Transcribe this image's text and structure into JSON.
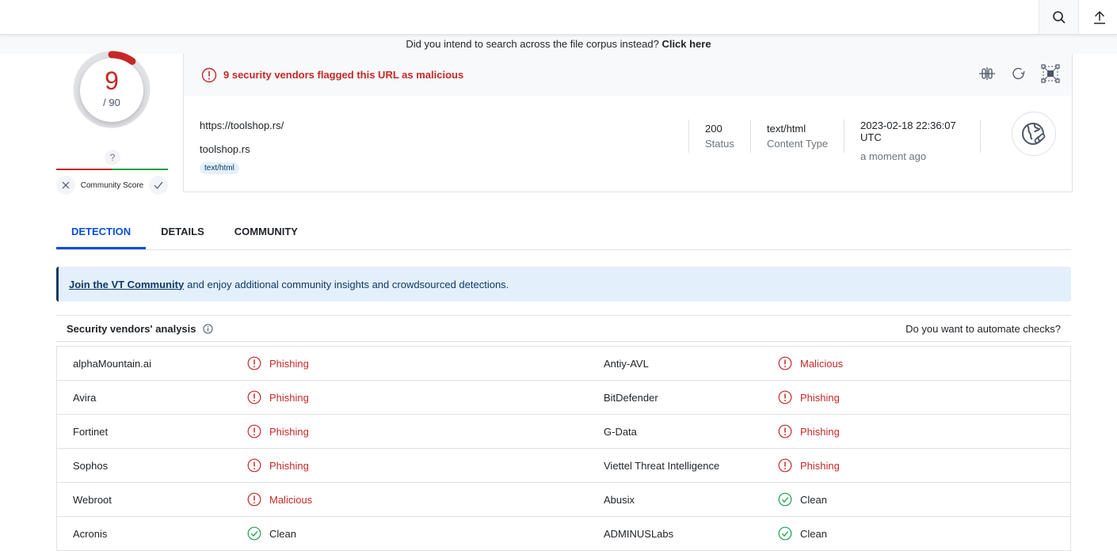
{
  "topbar": {
    "search_icon": "search-icon",
    "upload_icon": "upload-icon"
  },
  "notice": {
    "text": "Did you intend to search across the file corpus instead?",
    "link": "Click here"
  },
  "score": {
    "detections": "9",
    "total": "/ 90",
    "detection_fraction": 0.1,
    "community_unknown": "?",
    "community_label": "Community Score",
    "colors": {
      "malicious": "#c62828",
      "harmless": "#1e9e4a"
    }
  },
  "summary": {
    "alert": "9 security vendors flagged this URL as malicious",
    "url": "https://toolshop.rs/",
    "domain": "toolshop.rs",
    "tag": "text/html",
    "status_value": "200",
    "status_label": "Status",
    "content_type_value": "text/html",
    "content_type_label": "Content Type",
    "date": "2023-02-18 22:36:07 UTC",
    "relative": "a moment ago"
  },
  "tabs": [
    {
      "label": "DETECTION",
      "active": true
    },
    {
      "label": "DETAILS",
      "active": false
    },
    {
      "label": "COMMUNITY",
      "active": false
    }
  ],
  "banner": {
    "link": "Join the VT Community",
    "text": "and enjoy additional community insights and crowdsourced detections."
  },
  "analysis": {
    "title": "Security vendors' analysis",
    "automate": "Do you want to automate checks?",
    "rows": [
      [
        {
          "vendor": "alphaMountain.ai",
          "result": "Phishing",
          "status": "bad"
        },
        {
          "vendor": "Antiy-AVL",
          "result": "Malicious",
          "status": "bad"
        }
      ],
      [
        {
          "vendor": "Avira",
          "result": "Phishing",
          "status": "bad"
        },
        {
          "vendor": "BitDefender",
          "result": "Phishing",
          "status": "bad"
        }
      ],
      [
        {
          "vendor": "Fortinet",
          "result": "Phishing",
          "status": "bad"
        },
        {
          "vendor": "G-Data",
          "result": "Phishing",
          "status": "bad"
        }
      ],
      [
        {
          "vendor": "Sophos",
          "result": "Phishing",
          "status": "bad"
        },
        {
          "vendor": "Viettel Threat Intelligence",
          "result": "Phishing",
          "status": "bad"
        }
      ],
      [
        {
          "vendor": "Webroot",
          "result": "Malicious",
          "status": "bad"
        },
        {
          "vendor": "Abusix",
          "result": "Clean",
          "status": "good"
        }
      ],
      [
        {
          "vendor": "Acronis",
          "result": "Clean",
          "status": "good"
        },
        {
          "vendor": "ADMINUSLabs",
          "result": "Clean",
          "status": "good"
        }
      ]
    ]
  }
}
